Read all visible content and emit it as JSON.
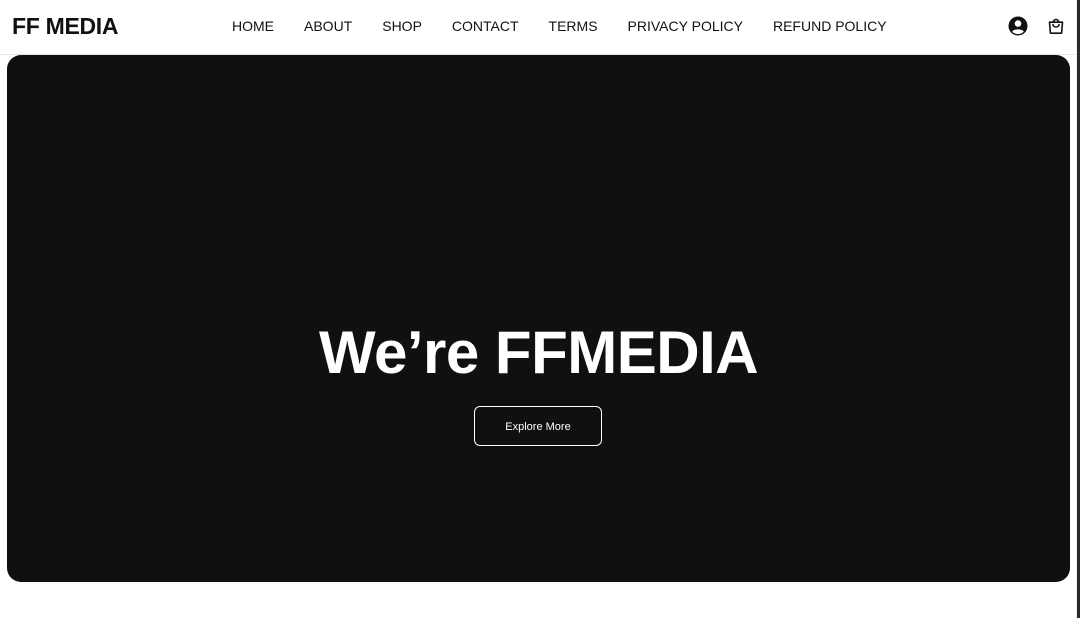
{
  "header": {
    "logo": "FF MEDIA",
    "nav": [
      {
        "label": "HOME"
      },
      {
        "label": "ABOUT"
      },
      {
        "label": "SHOP"
      },
      {
        "label": "CONTACT"
      },
      {
        "label": "TERMS"
      },
      {
        "label": "PRIVACY POLICY"
      },
      {
        "label": "REFUND POLICY"
      }
    ],
    "icons": {
      "account": "account-icon",
      "cart": "shopping-bag-icon"
    }
  },
  "hero": {
    "title": "We’re FFMEDIA",
    "button_label": "Explore More"
  },
  "colors": {
    "hero_background": "#101010",
    "text_dark": "#111111",
    "text_light": "#ffffff"
  }
}
